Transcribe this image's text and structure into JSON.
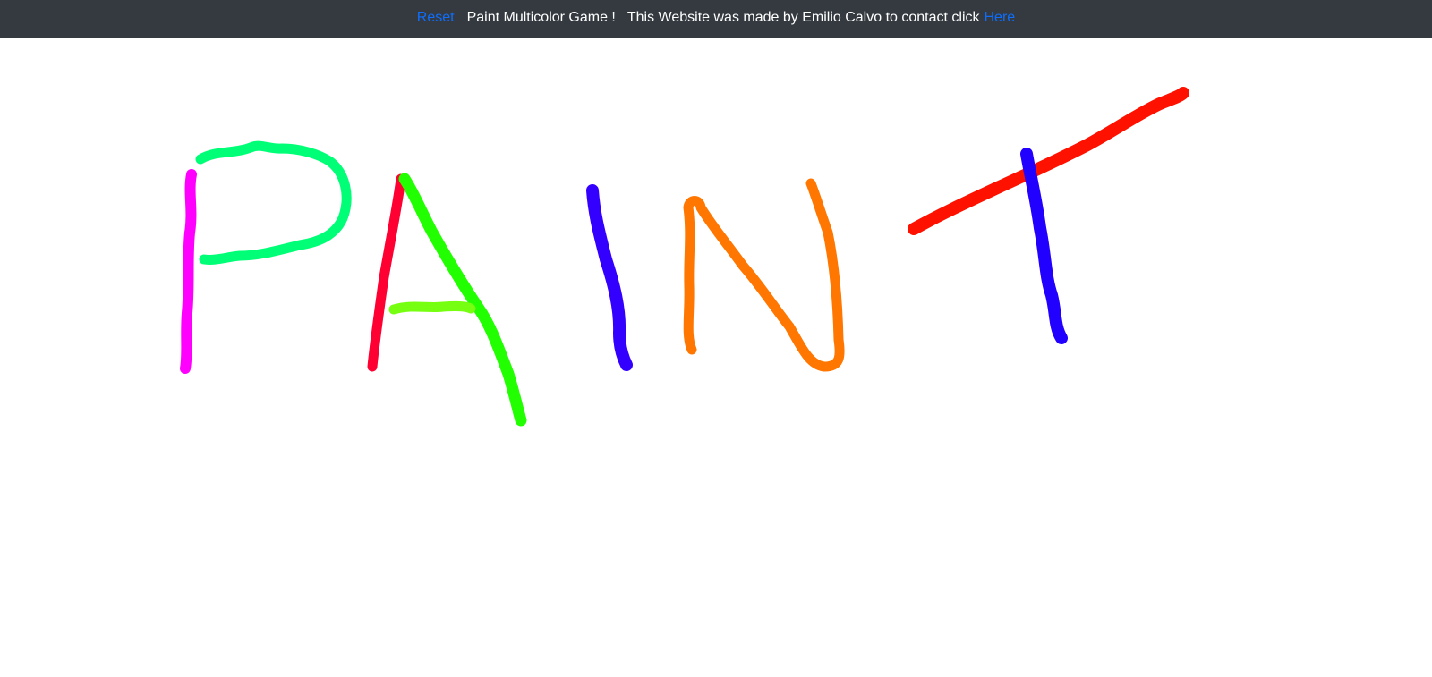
{
  "navbar": {
    "reset_label": "Reset",
    "title": "Paint Multicolor Game !",
    "credit_text": "This Website was made by Emilio Calvo to contact click",
    "contact_label": "Here"
  },
  "colors": {
    "navbar_bg": "#343a40",
    "link": "#0d6efd",
    "canvas_bg": "#ffffff",
    "strokes": [
      "#ff00ff",
      "#00ff77",
      "#ff0033",
      "#22ff00",
      "#77ff11",
      "#3300ff",
      "#ff7700",
      "#ff1100",
      "#2200ff"
    ]
  }
}
